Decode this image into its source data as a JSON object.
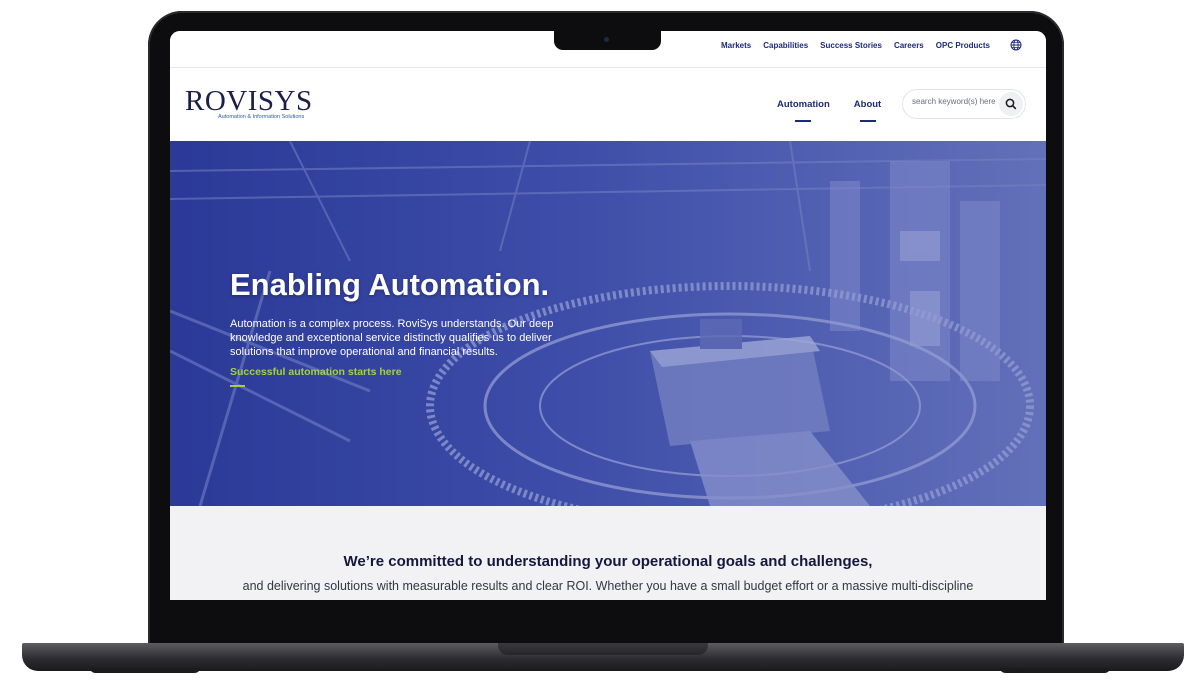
{
  "utility_nav": {
    "links": [
      "Markets",
      "Capabilities",
      "Success Stories",
      "Careers",
      "OPC Products"
    ],
    "globe_icon": "globe-icon"
  },
  "header": {
    "logo_text": "ROVISYS",
    "logo_tagline": "Automation & Information Solutions",
    "nav": [
      "Automation",
      "About"
    ],
    "search": {
      "placeholder": "search keyword(s) here",
      "icon": "search-icon"
    }
  },
  "hero": {
    "title": "Enabling Automation.",
    "description": "Automation is a complex process. RoviSys understands. Our deep knowledge and exceptional service distinctly qualifies us to deliver solutions that improve operational and financial results.",
    "link": "Successful automation starts here"
  },
  "intro": {
    "heading": "We’re committed to understanding your operational goals and challenges,",
    "body": "and delivering solutions with measurable results and clear ROI. Whether you have a small budget effort or a massive multi-discipline"
  },
  "colors": {
    "brand_navy": "#1d2a7a",
    "link_green": "#a5d23a",
    "hero_overlay": "#3a4aa6",
    "intro_bg": "#f2f2f4"
  }
}
